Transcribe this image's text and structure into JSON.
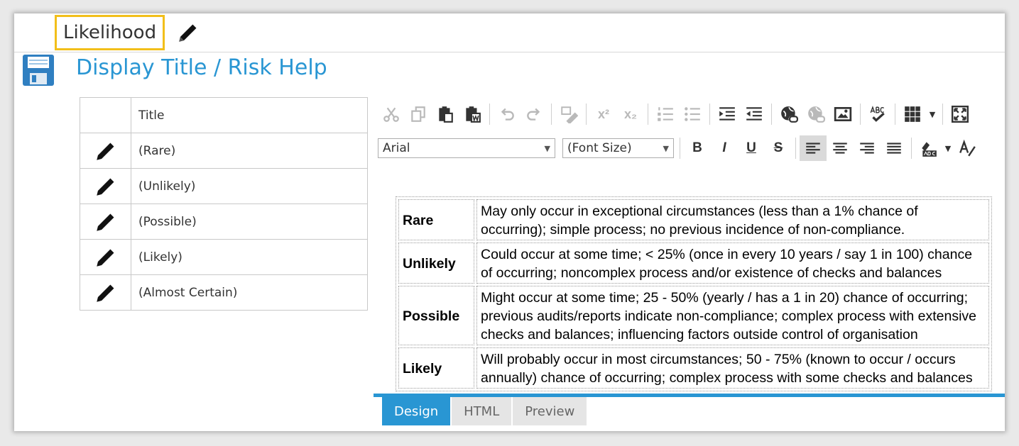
{
  "header": {
    "title": "Likelihood",
    "section_title": "Display Title / Risk Help"
  },
  "grid": {
    "column_title": "Title",
    "rows": [
      "(Rare)",
      "(Unlikely)",
      "(Possible)",
      "(Likely)",
      "(Almost Certain)"
    ]
  },
  "editor": {
    "font_select": "Arial",
    "size_select": "(Font Size)",
    "toolbar_icons": [
      "cut-icon",
      "copy-icon",
      "paste-icon",
      "paste-from-word-icon",
      "undo-icon",
      "redo-icon",
      "format-stripper-icon",
      "superscript-icon",
      "subscript-icon",
      "numbered-list-icon",
      "bulleted-list-icon",
      "indent-icon",
      "outdent-icon",
      "insert-link-icon",
      "remove-link-icon",
      "insert-image-icon",
      "spellcheck-icon",
      "insert-table-icon",
      "fullscreen-icon"
    ],
    "format_labels": {
      "bold": "B",
      "italic": "I",
      "underline": "U",
      "strike": "S"
    },
    "content_rows": [
      {
        "level": "Rare",
        "description": "May only occur in exceptional circumstances (less than a 1% chance of occurring); simple process; no previous incidence of non-compliance."
      },
      {
        "level": "Unlikely",
        "description": "Could occur at some time; < 25% (once in every 10 years / say 1 in 100) chance of occurring; noncomplex process and/or existence of checks and balances"
      },
      {
        "level": "Possible",
        "description": "Might occur at some time; 25 - 50% (yearly / has a 1 in 20) chance of occurring; previous audits/reports indicate non-compliance; complex process with extensive checks and balances; influencing factors outside control of organisation"
      },
      {
        "level": "Likely",
        "description": "Will probably occur in most circumstances; 50 - 75% (known to occur / occurs annually) chance of occurring; complex process with some checks and balances"
      }
    ],
    "mode_tabs": [
      "Design",
      "HTML",
      "Preview"
    ],
    "active_mode": "Design"
  },
  "colors": {
    "accent": "#2996d3",
    "highlight_border": "#f2bf1a"
  }
}
